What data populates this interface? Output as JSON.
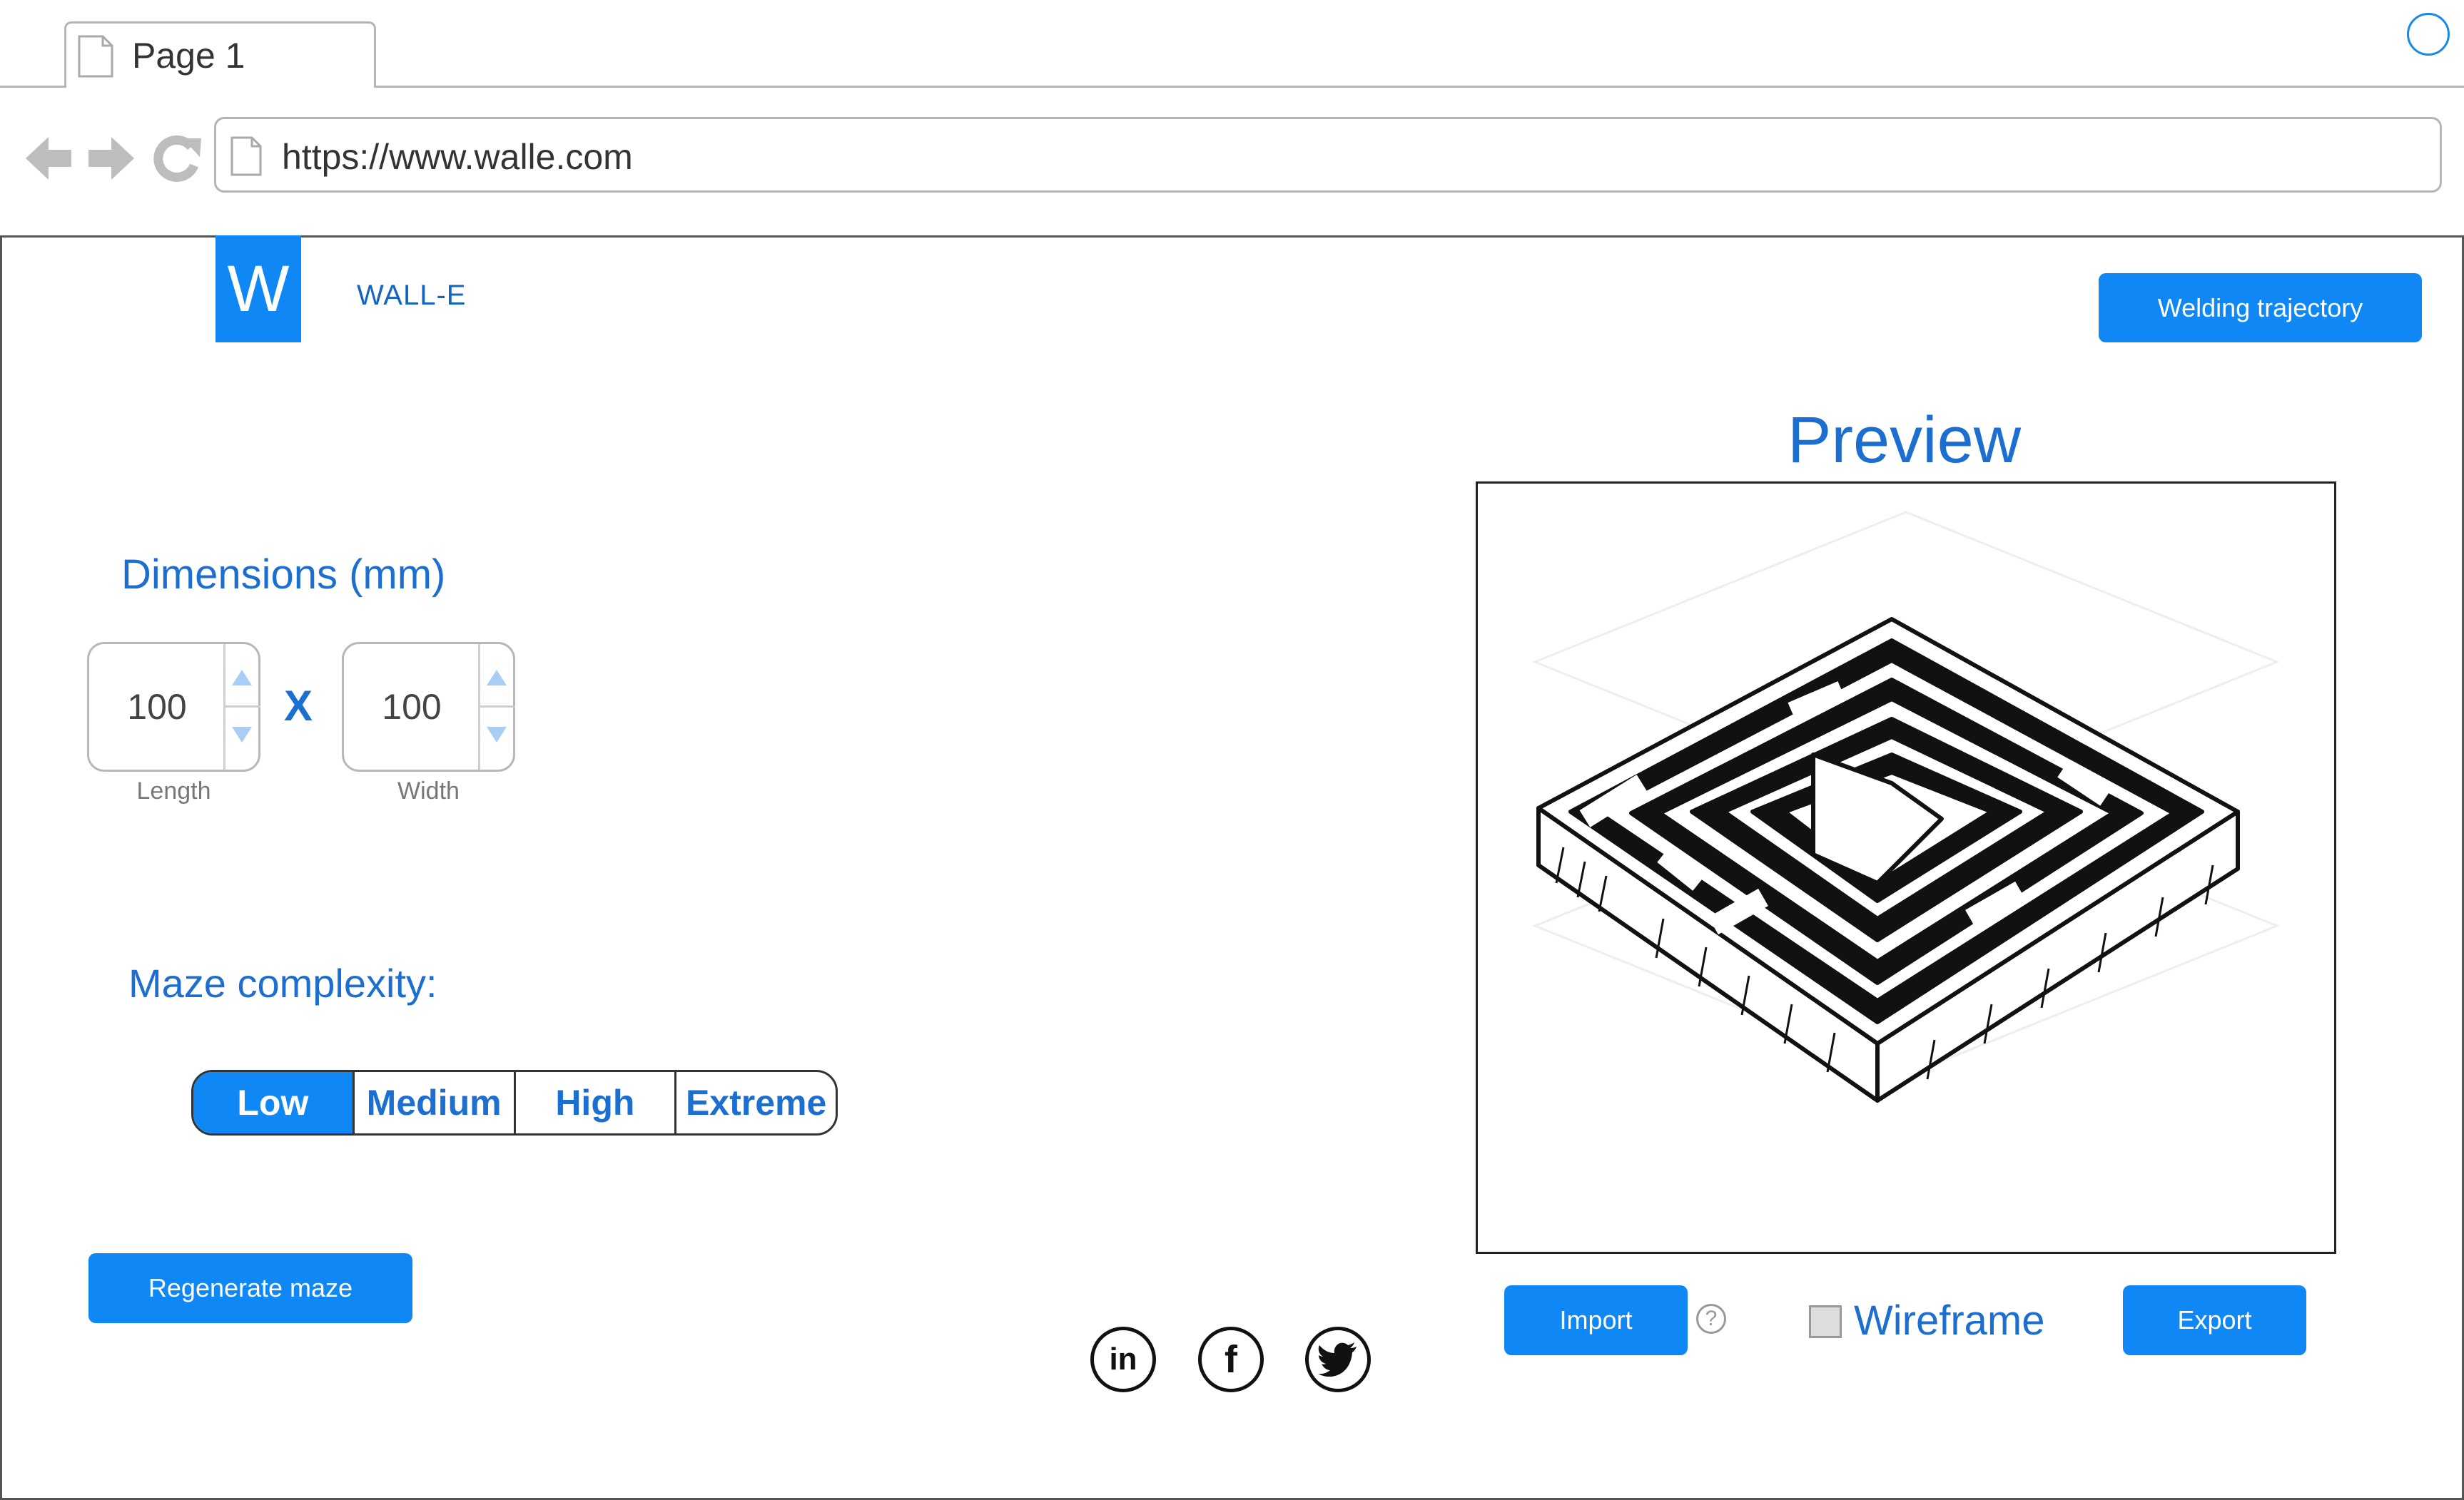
{
  "browser": {
    "tab_label": "Page 1",
    "url": "https://www.walle.com"
  },
  "app": {
    "logo_letter": "W",
    "brand": "WALL-E",
    "welding_button": "Welding trajectory"
  },
  "dimensions": {
    "title": "Dimensions (mm)",
    "length_value": "100",
    "length_label": "Length",
    "separator": "X",
    "width_value": "100",
    "width_label": "Width"
  },
  "complexity": {
    "title": "Maze complexity:",
    "options": [
      "Low",
      "Medium",
      "High",
      "Extreme"
    ],
    "selected": "Low"
  },
  "regenerate_button": "Regenerate maze",
  "preview": {
    "title": "Preview",
    "import_button": "Import",
    "help_symbol": "?",
    "wireframe_label": "Wireframe",
    "wireframe_checked": false,
    "export_button": "Export"
  },
  "social": {
    "linkedin": "in",
    "facebook": "f"
  },
  "colors": {
    "accent": "#0f87f4",
    "heading": "#1c6fd0"
  }
}
